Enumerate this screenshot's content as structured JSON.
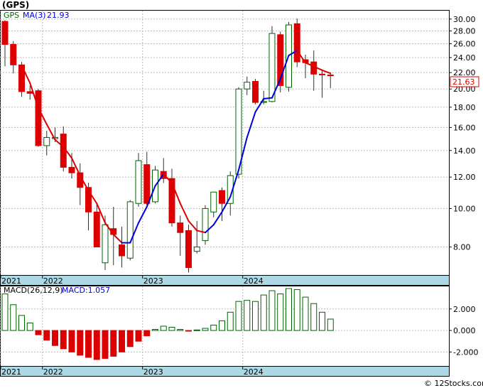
{
  "title": "(GPS)",
  "watermark": "© 12Stocks.com",
  "colors": {
    "up": "#006400",
    "down": "#dd0000",
    "ma_up": "#0000dd",
    "ma_down": "#dd0000",
    "axis_band": "#add8e6",
    "grid": "#bbbbbb"
  },
  "price_panel": {
    "legend_symbol": "GPS",
    "legend_ma": "MA(3)",
    "legend_ma_value": "21.93",
    "last_price_label": "21.63",
    "y_ticks": [
      "30.00",
      "28.00",
      "26.00",
      "24.00",
      "22.00",
      "20.00",
      "18.00",
      "16.00",
      "14.00",
      "12.00",
      "10.00",
      "8.00"
    ]
  },
  "macd_panel": {
    "legend": "MACD(26,12,9)",
    "legend_value": "MACD:1.057",
    "y_ticks": [
      "2.000",
      "0.000",
      "-2.000"
    ]
  },
  "x_labels": [
    {
      "label": "2021",
      "index": 0
    },
    {
      "label": "2022",
      "index": 5
    },
    {
      "label": "2023",
      "index": 17
    },
    {
      "label": "2024",
      "index": 29
    }
  ],
  "chart_data": {
    "type": "candlestick",
    "period": "monthly",
    "y_scale": "log",
    "ylim": [
      6.8,
      31.5
    ],
    "candles": [
      {
        "o": 29.6,
        "h": 29.8,
        "l": 22.8,
        "c": 25.9
      },
      {
        "o": 25.9,
        "h": 26.4,
        "l": 21.9,
        "c": 23.0
      },
      {
        "o": 23.0,
        "h": 23.4,
        "l": 19.1,
        "c": 19.7
      },
      {
        "o": 19.7,
        "h": 20.4,
        "l": 18.8,
        "c": 19.5
      },
      {
        "o": 19.8,
        "h": 20.0,
        "l": 14.3,
        "c": 14.4
      },
      {
        "o": 14.4,
        "h": 15.7,
        "l": 13.6,
        "c": 15.1
      },
      {
        "o": 15.0,
        "h": 16.0,
        "l": 14.7,
        "c": 15.1
      },
      {
        "o": 15.4,
        "h": 16.1,
        "l": 12.4,
        "c": 12.7
      },
      {
        "o": 12.7,
        "h": 13.8,
        "l": 11.9,
        "c": 12.3
      },
      {
        "o": 12.3,
        "h": 13.0,
        "l": 10.2,
        "c": 11.3
      },
      {
        "o": 11.3,
        "h": 11.6,
        "l": 8.8,
        "c": 9.8
      },
      {
        "o": 9.8,
        "h": 10.3,
        "l": 8.3,
        "c": 8.0
      },
      {
        "o": 7.3,
        "h": 9.6,
        "l": 7.0,
        "c": 9.1
      },
      {
        "o": 8.9,
        "h": 10.1,
        "l": 7.2,
        "c": 8.6
      },
      {
        "o": 8.1,
        "h": 9.0,
        "l": 7.1,
        "c": 7.6
      },
      {
        "o": 7.5,
        "h": 10.5,
        "l": 7.4,
        "c": 10.4
      },
      {
        "o": 10.3,
        "h": 13.8,
        "l": 10.1,
        "c": 13.2
      },
      {
        "o": 12.9,
        "h": 13.9,
        "l": 10.2,
        "c": 10.3
      },
      {
        "o": 10.4,
        "h": 12.8,
        "l": 10.3,
        "c": 12.5
      },
      {
        "o": 12.4,
        "h": 13.4,
        "l": 11.6,
        "c": 11.9
      },
      {
        "o": 11.9,
        "h": 12.6,
        "l": 9.0,
        "c": 9.2
      },
      {
        "o": 9.2,
        "h": 9.6,
        "l": 7.6,
        "c": 8.7
      },
      {
        "o": 8.8,
        "h": 9.1,
        "l": 6.9,
        "c": 7.1
      },
      {
        "o": 7.8,
        "h": 9.3,
        "l": 7.7,
        "c": 8.0
      },
      {
        "o": 8.3,
        "h": 10.2,
        "l": 8.1,
        "c": 10.0
      },
      {
        "o": 9.8,
        "h": 11.0,
        "l": 9.5,
        "c": 11.0
      },
      {
        "o": 11.1,
        "h": 11.3,
        "l": 9.3,
        "c": 10.3
      },
      {
        "o": 10.3,
        "h": 12.4,
        "l": 9.6,
        "c": 12.1
      },
      {
        "o": 12.2,
        "h": 20.2,
        "l": 11.9,
        "c": 20.0
      },
      {
        "o": 20.0,
        "h": 21.5,
        "l": 19.3,
        "c": 20.8
      },
      {
        "o": 20.9,
        "h": 21.2,
        "l": 18.3,
        "c": 18.5
      },
      {
        "o": 18.5,
        "h": 19.8,
        "l": 18.3,
        "c": 18.6
      },
      {
        "o": 18.6,
        "h": 28.8,
        "l": 18.5,
        "c": 27.6
      },
      {
        "o": 27.4,
        "h": 27.9,
        "l": 19.6,
        "c": 20.4
      },
      {
        "o": 20.2,
        "h": 29.5,
        "l": 19.7,
        "c": 29.0
      },
      {
        "o": 29.2,
        "h": 30.1,
        "l": 22.7,
        "c": 23.4
      },
      {
        "o": 23.7,
        "h": 24.4,
        "l": 21.3,
        "c": 23.3
      },
      {
        "o": 23.4,
        "h": 25.0,
        "l": 19.8,
        "c": 21.8
      },
      {
        "o": 21.8,
        "h": 22.4,
        "l": 19.0,
        "c": 21.7
      },
      {
        "o": 21.7,
        "h": 22.0,
        "l": 20.1,
        "c": 21.6
      }
    ],
    "ma3": [
      null,
      null,
      22.9,
      20.7,
      17.9,
      16.3,
      14.9,
      14.3,
      13.4,
      12.1,
      11.1,
      10.3,
      9.2,
      8.6,
      8.2,
      8.2,
      9.2,
      10.1,
      11.4,
      12.2,
      11.6,
      10.3,
      9.3,
      8.8,
      8.7,
      9.1,
      9.8,
      10.7,
      12.5,
      15.1,
      17.5,
      18.9,
      19.0,
      21.2,
      24.3,
      25.0,
      23.3,
      22.8,
      22.3,
      21.9
    ],
    "macd_hist": [
      3.4,
      2.4,
      1.4,
      0.7,
      -0.4,
      -0.9,
      -1.4,
      -1.7,
      -2.0,
      -2.3,
      -2.5,
      -2.7,
      -2.6,
      -2.4,
      -2.0,
      -1.5,
      -1.0,
      -0.5,
      0.1,
      0.4,
      0.3,
      0.1,
      -0.05,
      0.05,
      0.2,
      0.5,
      0.9,
      1.7,
      2.7,
      2.8,
      2.7,
      3.3,
      3.7,
      3.4,
      3.9,
      3.8,
      3.1,
      2.5,
      1.7,
      1.06
    ]
  }
}
